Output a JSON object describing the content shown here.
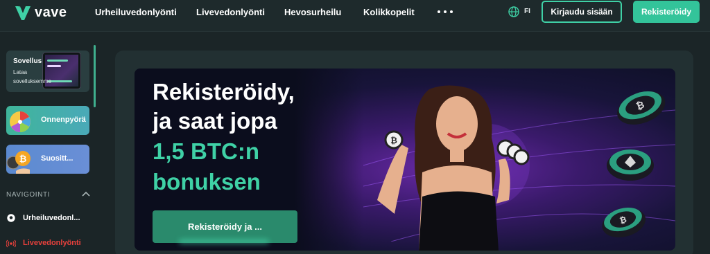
{
  "brand": {
    "name": "vave"
  },
  "header": {
    "nav": [
      "Urheiluvedonlyönti",
      "Livevedonlyönti",
      "Hevosurheilu",
      "Kolikkopelit"
    ],
    "language": "FI",
    "login_label": "Kirjaudu sisään",
    "register_label": "Rekisteröidy"
  },
  "sidebar": {
    "app_card": {
      "title": "Sovellus",
      "subtitle": "Lataa sovelluksemme"
    },
    "promos": [
      {
        "label": "Onnenpyörä",
        "icon": "wheel-icon"
      },
      {
        "label": "Suosittele",
        "display": "Suositt...",
        "icon": "bitcoin-coin-icon"
      }
    ],
    "nav_title": "NAVIGOINTI",
    "nav_items": [
      {
        "label": "Urheiluvedonl...",
        "icon": "soccer-ball-icon",
        "color": "#ffffff"
      },
      {
        "label": "Livevedonlyönti",
        "icon": "live-broadcast-icon",
        "color": "#e8413c"
      }
    ]
  },
  "banner": {
    "line1": "Rekisteröidy,",
    "line2": "ja saat jopa",
    "line3": "1,5 BTC:n",
    "line4": "bonuksen",
    "cta_label": "Rekisteröidy ja ..."
  },
  "colors": {
    "accent": "#3fd1a6",
    "background": "#1b2527",
    "live": "#e8413c"
  }
}
